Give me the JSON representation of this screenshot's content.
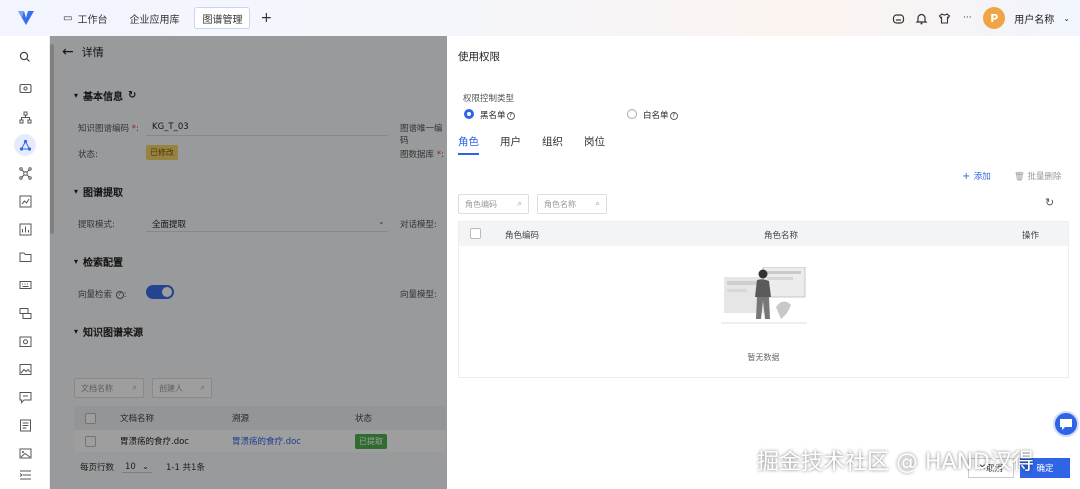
{
  "topbar": {
    "tabs": [
      {
        "label": "工作台"
      },
      {
        "label": "企业应用库"
      },
      {
        "label": "图谱管理"
      }
    ],
    "add_label": "+",
    "user_initial": "P",
    "user_name": "用户名称",
    "more": "···"
  },
  "main": {
    "back_label": "详情",
    "sections": {
      "basic": "基本信息",
      "extract": "图谱提取",
      "search": "检索配置",
      "source": "知识图谱来源"
    },
    "fields": {
      "code_label": "知识图谱编码",
      "code_value": "KG_T_03",
      "unique_label": "图谱唯一编码",
      "status_label": "状态:",
      "status_value": "已修改",
      "db_label": "图数据库",
      "mode_label": "提取模式:",
      "mode_value": "全面提取",
      "dialog_model_label": "对话模型:",
      "vector_label": "向量检索",
      "vector_model_label": "向量模型:"
    },
    "source_search": {
      "doc_placeholder": "文档名称",
      "creator_placeholder": "创建人"
    },
    "source_table": {
      "headers": [
        "文档名称",
        "溯源",
        "状态"
      ],
      "rows": [
        {
          "name": "胃溃疡的食疗.doc",
          "trace": "胃溃疡的食疗.doc",
          "status": "已提取"
        }
      ],
      "per_page_label": "每页行数",
      "per_page_value": "10",
      "range": "1-1 共1条"
    }
  },
  "panel": {
    "title": "使用权限",
    "type_label": "权限控制类型",
    "blacklist": "黑名单",
    "whitelist": "白名单",
    "tabs": [
      "角色",
      "用户",
      "组织",
      "岗位"
    ],
    "add_label": "添加",
    "batch_delete_label": "批量删除",
    "search_code_placeholder": "角色编码",
    "search_name_placeholder": "角色名称",
    "table_headers": [
      "角色编码",
      "角色名称",
      "操作"
    ],
    "empty_text": "暂无数据",
    "cancel_label": "取消",
    "ok_label": "确定"
  },
  "watermark": "掘金技术社区 @ HAND汉得",
  "colors": {
    "accent": "#2f64e6",
    "status_modified": "#f3d36a",
    "status_extracted": "#4caf50",
    "avatar": "#f0a545"
  }
}
